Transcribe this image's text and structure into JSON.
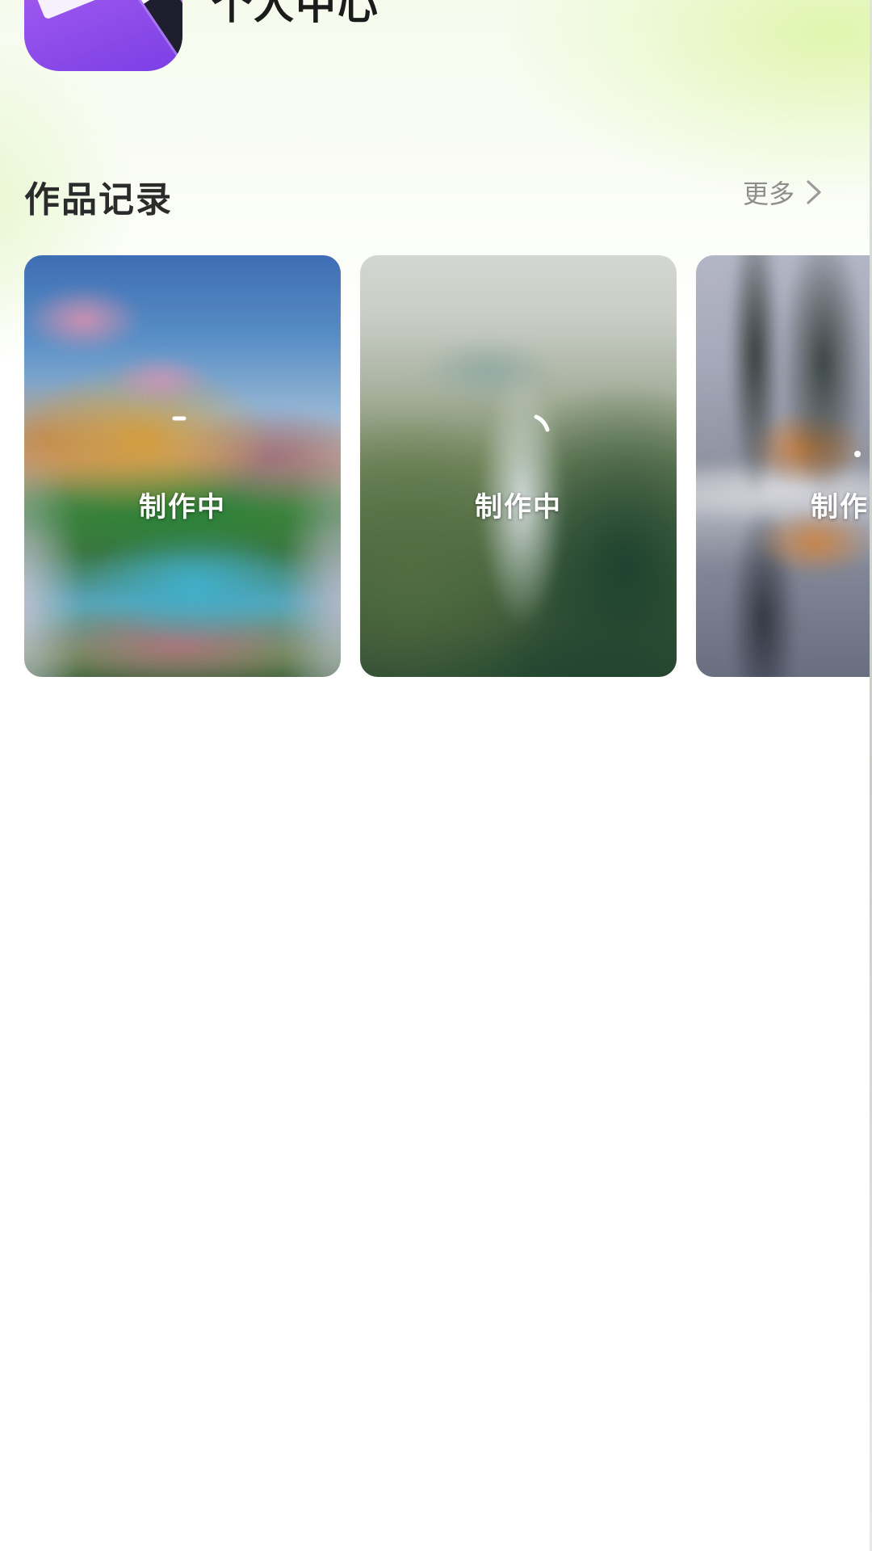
{
  "header": {
    "title": "个人中心",
    "app_icon": "magic-wand-paper-icon"
  },
  "works_section": {
    "title": "作品记录",
    "more_label": "更多",
    "more_icon": "chevron-right-icon",
    "cards": [
      {
        "status": "制作中",
        "scene": "mountain-lake"
      },
      {
        "status": "制作中",
        "scene": "waterfall-forest"
      },
      {
        "status": "制作中",
        "scene": "misty-lake-trees"
      }
    ]
  },
  "colors": {
    "app_icon_purple": "#9a55ee",
    "title_text": "#1b1b1b",
    "more_text": "#8d8d8d",
    "header_glow": "#def5aa"
  }
}
